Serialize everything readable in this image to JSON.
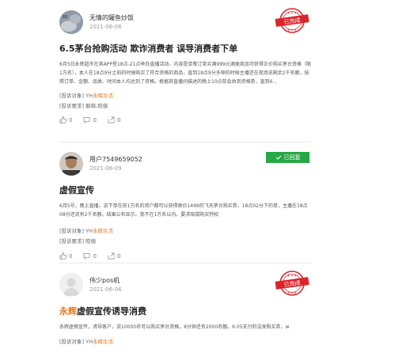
{
  "posts": [
    {
      "username": "无情的罐鱼炒饭",
      "date": "2021-06-06",
      "badge": "已完成",
      "title": "6.5茅台抢购活动 欺诈消费者 误导消费者下单",
      "body": "6月5日永辉超市在其APP里18点-21点举办直播活动，内容是单笔订单买满999元酒类商品可获得正价购买茅台资格（限1万名），本人在18点9分之前的时候购买了符合资格的商品，直到18点9分多钟的时候主播还在现场说剩余2千名额，按照订单、金额、品类、时间本人均达到了资格。根据其直播间描述的晚上10点前会收到资格券，直到6...",
      "target_label": "[投诉对象]",
      "target": "YH永辉生活",
      "request_label": "[投诉要求]",
      "request": "解释,赔偿",
      "like": "0",
      "comment": "0",
      "share": "0"
    },
    {
      "username": "用户7549659052",
      "date": "2021-06-09",
      "badge": "已回复",
      "title": "虚假宣传",
      "body": "6月5号，晚上直播。说下单在前1万名的用户都可以获得原价1499的飞天茅台购买券，18点02分下的单，主播在18点08分还说有2千名额。结果公布显示。我不在1万名以内。要求赔偿购买特权",
      "target_label": "[投诉对象]",
      "target": "YH永辉生活",
      "request_label": "[投诉要求]",
      "request": "赔偿",
      "like": "0",
      "comment": "0",
      "share": "0"
    },
    {
      "username": "伟少pos机",
      "date": "2021-06-06",
      "badge": "已完成",
      "title_highlight": "永辉",
      "title_rest": "虚假宣传诱导消费",
      "body": "永辉虚假宣传，诱导客户，说10000名可以购买茅台资格，8分钟还有2000名额。6.05支付的没发购买券，w",
      "target_label": "[投诉对象]",
      "target": "YH永辉生活"
    }
  ],
  "colors": {
    "accent_orange": "#e8791d",
    "stamp_red": "#d9252b",
    "reply_green": "#26a844"
  },
  "icons": [
    "like-icon",
    "comment-icon",
    "share-icon",
    "check-icon"
  ]
}
